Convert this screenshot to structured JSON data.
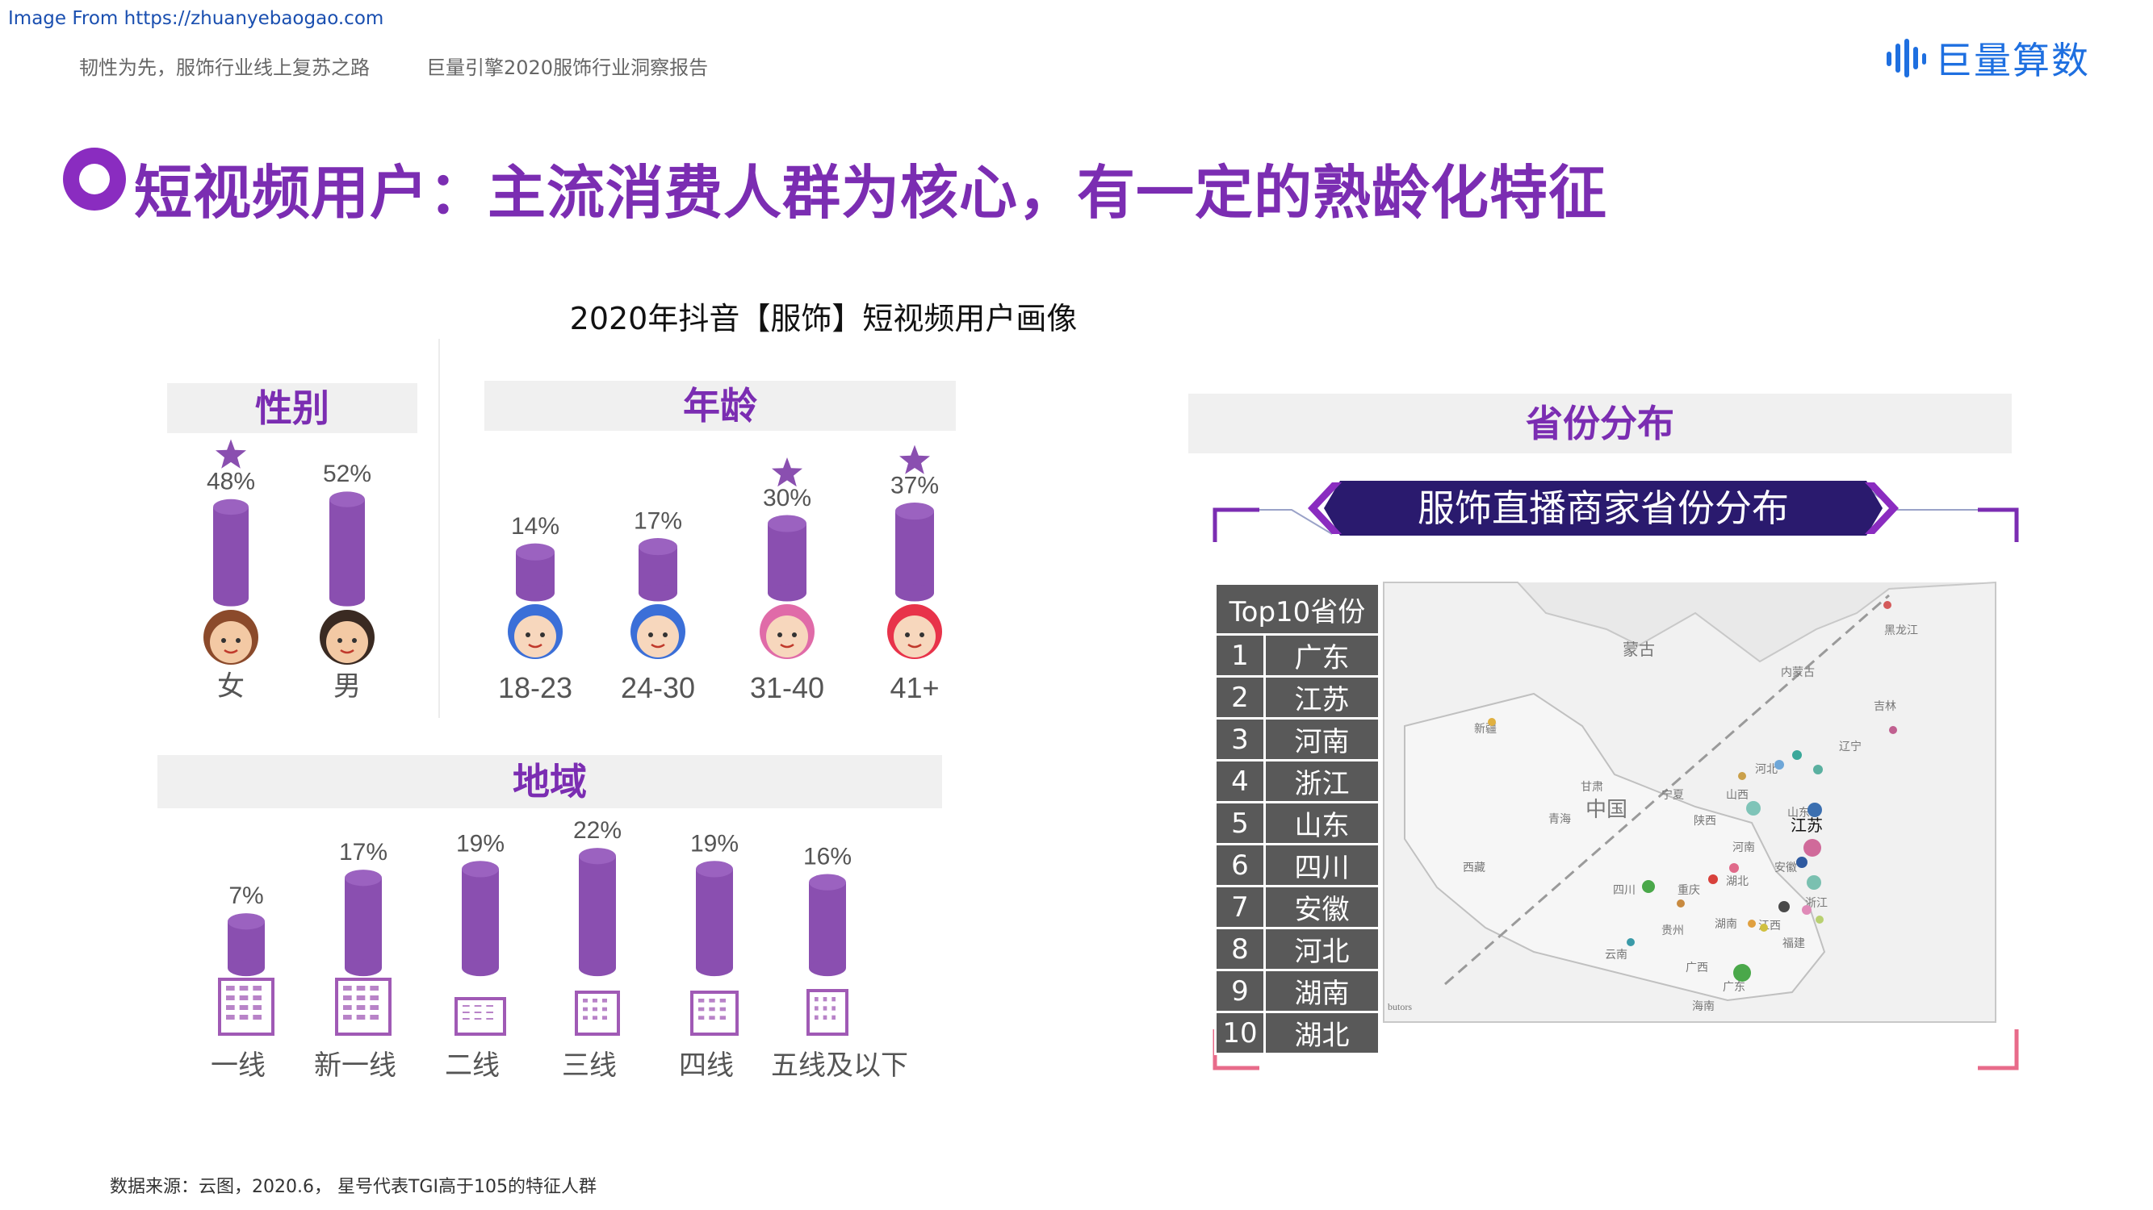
{
  "watermark": "Image From https://zhuanyebaogao.com",
  "header": {
    "left": "韧性为先，服饰行业线上复苏之路",
    "middle": "巨量引擎2020服饰行业洞察报告"
  },
  "brand": {
    "name": "巨量算数",
    "accent": "#1e6fe0"
  },
  "title": "短视频用户：主流消费人群为核心，有一定的熟龄化特征",
  "colors": {
    "bar": "#8a4fb0",
    "title": "#7b2db2",
    "building": "#a05ab5",
    "band": "#f0f0f0"
  },
  "chart_title": "2020年抖音【服饰】短视频用户画像",
  "sections": {
    "gender": "性别",
    "age": "年龄",
    "region": "地域",
    "province": "省份分布"
  },
  "chart_data": [
    {
      "type": "bar",
      "title": "性别",
      "categories": [
        "女",
        "男"
      ],
      "values": [
        48,
        52
      ],
      "unit": "%",
      "starred": [
        true,
        false
      ]
    },
    {
      "type": "bar",
      "title": "年龄",
      "categories": [
        "18-23",
        "24-30",
        "31-40",
        "41+"
      ],
      "values": [
        14,
        17,
        30,
        37
      ],
      "unit": "%",
      "starred": [
        false,
        false,
        true,
        true
      ]
    },
    {
      "type": "bar",
      "title": "地域",
      "categories": [
        "一线",
        "新一线",
        "二线",
        "三线",
        "四线",
        "五线及以下"
      ],
      "values": [
        7,
        17,
        19,
        22,
        19,
        16
      ],
      "unit": "%",
      "starred": [
        false,
        false,
        false,
        false,
        false,
        false
      ]
    },
    {
      "type": "table",
      "title": "服饰直播商家省份分布",
      "header": "Top10省份",
      "rows": [
        [
          "1",
          "广东"
        ],
        [
          "2",
          "江苏"
        ],
        [
          "3",
          "河南"
        ],
        [
          "4",
          "浙江"
        ],
        [
          "5",
          "山东"
        ],
        [
          "6",
          "四川"
        ],
        [
          "7",
          "安徽"
        ],
        [
          "8",
          "河北"
        ],
        [
          "9",
          "湖南"
        ],
        [
          "10",
          "湖北"
        ]
      ]
    }
  ],
  "map": {
    "labels": [
      "蒙古",
      "中国",
      "黑龙江",
      "内蒙古",
      "吉林",
      "辽宁",
      "新疆",
      "甘肃",
      "宁夏",
      "山西",
      "河北",
      "青海",
      "陕西",
      "山东",
      "江苏",
      "河南",
      "安徽",
      "西藏",
      "四川",
      "重庆",
      "湖北",
      "浙江",
      "贵州",
      "湖南",
      "江西",
      "云南",
      "广西",
      "广东",
      "福建",
      "海南",
      "butors"
    ],
    "highlight_label": "江苏"
  },
  "footnote": "数据来源：云图，2020.6， 星号代表TGI高于105的特征人群"
}
